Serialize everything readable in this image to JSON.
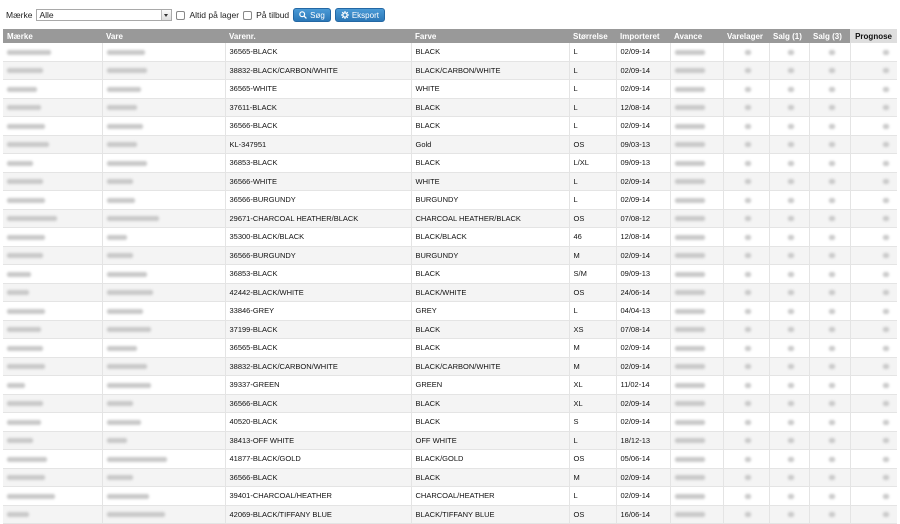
{
  "filters": {
    "brand_label": "Mærke",
    "brand_value": "Alle",
    "always_in_stock_label": "Altid på lager",
    "on_offer_label": "På tilbud",
    "search_button": "Søg",
    "export_button": "Eksport"
  },
  "table": {
    "headers": [
      "Mærke",
      "Vare",
      "Varenr.",
      "Farve",
      "Størrelse",
      "Importeret",
      "Avance",
      "Varelager",
      "Salg (1)",
      "Salg (3)",
      "Prognose"
    ],
    "rows": [
      {
        "varenr": "36565-BLACK",
        "farve": "BLACK",
        "size": "L",
        "imported": "02/09-14"
      },
      {
        "varenr": "38832-BLACK/CARBON/WHITE",
        "farve": "BLACK/CARBON/WHITE",
        "size": "L",
        "imported": "02/09-14"
      },
      {
        "varenr": "36565-WHITE",
        "farve": "WHITE",
        "size": "L",
        "imported": "02/09-14"
      },
      {
        "varenr": "37611-BLACK",
        "farve": "BLACK",
        "size": "L",
        "imported": "12/08-14"
      },
      {
        "varenr": "36566-BLACK",
        "farve": "BLACK",
        "size": "L",
        "imported": "02/09-14"
      },
      {
        "varenr": "KL-347951",
        "farve": "Gold",
        "size": "OS",
        "imported": "09/03-13"
      },
      {
        "varenr": "36853-BLACK",
        "farve": "BLACK",
        "size": "L/XL",
        "imported": "09/09-13"
      },
      {
        "varenr": "36566-WHITE",
        "farve": "WHITE",
        "size": "L",
        "imported": "02/09-14"
      },
      {
        "varenr": "36566-BURGUNDY",
        "farve": "BURGUNDY",
        "size": "L",
        "imported": "02/09-14"
      },
      {
        "varenr": "29671-CHARCOAL HEATHER/BLACK",
        "farve": "CHARCOAL HEATHER/BLACK",
        "size": "OS",
        "imported": "07/08-12"
      },
      {
        "varenr": "35300-BLACK/BLACK",
        "farve": "BLACK/BLACK",
        "size": "46",
        "imported": "12/08-14"
      },
      {
        "varenr": "36566-BURGUNDY",
        "farve": "BURGUNDY",
        "size": "M",
        "imported": "02/09-14"
      },
      {
        "varenr": "36853-BLACK",
        "farve": "BLACK",
        "size": "S/M",
        "imported": "09/09-13"
      },
      {
        "varenr": "42442-BLACK/WHITE",
        "farve": "BLACK/WHITE",
        "size": "OS",
        "imported": "24/06-14"
      },
      {
        "varenr": "33846-GREY",
        "farve": "GREY",
        "size": "L",
        "imported": "04/04-13"
      },
      {
        "varenr": "37199-BLACK",
        "farve": "BLACK",
        "size": "XS",
        "imported": "07/08-14"
      },
      {
        "varenr": "36565-BLACK",
        "farve": "BLACK",
        "size": "M",
        "imported": "02/09-14"
      },
      {
        "varenr": "38832-BLACK/CARBON/WHITE",
        "farve": "BLACK/CARBON/WHITE",
        "size": "M",
        "imported": "02/09-14"
      },
      {
        "varenr": "39337-GREEN",
        "farve": "GREEN",
        "size": "XL",
        "imported": "11/02-14"
      },
      {
        "varenr": "36566-BLACK",
        "farve": "BLACK",
        "size": "XL",
        "imported": "02/09-14"
      },
      {
        "varenr": "40520-BLACK",
        "farve": "BLACK",
        "size": "S",
        "imported": "02/09-14"
      },
      {
        "varenr": "38413-OFF WHITE",
        "farve": "OFF WHITE",
        "size": "L",
        "imported": "18/12-13"
      },
      {
        "varenr": "41877-BLACK/GOLD",
        "farve": "BLACK/GOLD",
        "size": "OS",
        "imported": "05/06-14"
      },
      {
        "varenr": "36566-BLACK",
        "farve": "BLACK",
        "size": "M",
        "imported": "02/09-14"
      },
      {
        "varenr": "39401-CHARCOAL/HEATHER",
        "farve": "CHARCOAL/HEATHER",
        "size": "L",
        "imported": "02/09-14"
      },
      {
        "varenr": "42069-BLACK/TIFFANY BLUE",
        "farve": "BLACK/TIFFANY BLUE",
        "size": "OS",
        "imported": "16/06-14"
      }
    ]
  }
}
